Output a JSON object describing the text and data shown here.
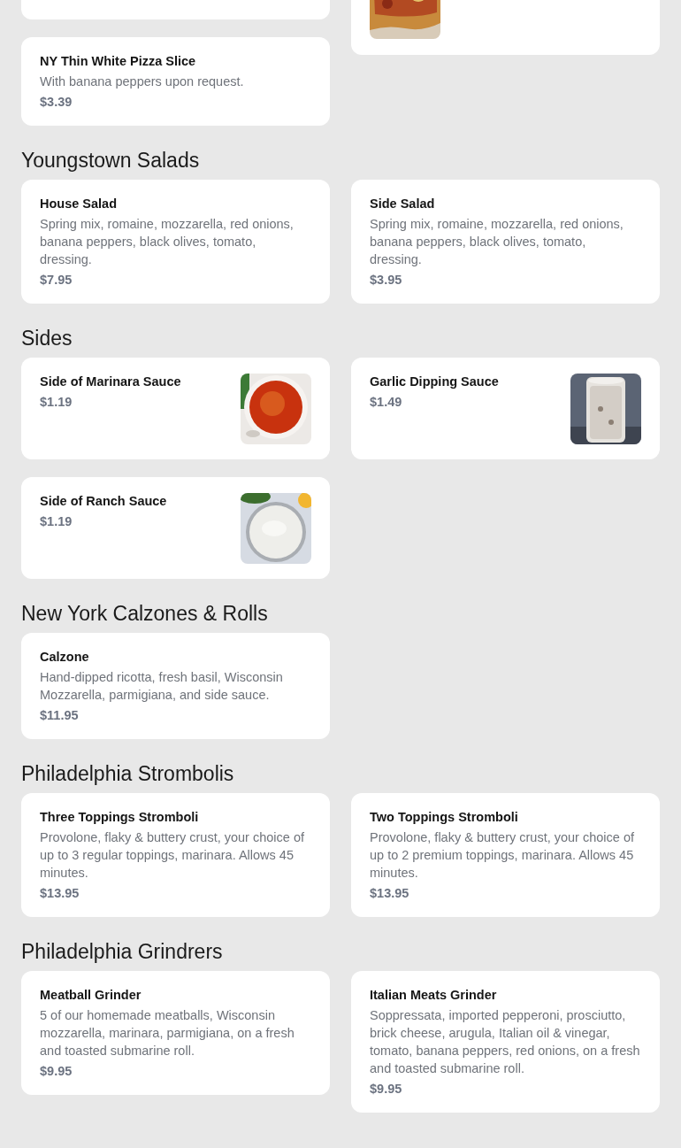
{
  "sections": [
    {
      "items": [
        {
          "kind": "cut"
        },
        {
          "kind": "cut"
        },
        {
          "kind": "item",
          "name": "NY Thin White Pizza Slice",
          "description": "With banana peppers upon request.",
          "price": "$3.39"
        }
      ]
    },
    {
      "heading": "Youngstown Salads",
      "items": [
        {
          "kind": "item",
          "name": "House Salad",
          "description": "Spring mix, romaine, mozzarella, red onions, banana peppers, black olives, tomato, dressing.",
          "price": "$7.95"
        },
        {
          "kind": "item",
          "name": "Side Salad",
          "description": "Spring mix, romaine, mozzarella, red onions, banana peppers, black olives, tomato, dressing.",
          "price": "$3.95"
        }
      ]
    },
    {
      "heading": "Sides",
      "items": [
        {
          "kind": "item",
          "name": "Side of Marinara Sauce",
          "price": "$1.19"
        },
        {
          "kind": "item",
          "name": "Garlic Dipping Sauce",
          "price": "$1.49"
        },
        {
          "kind": "item",
          "name": "Side of Ranch Sauce",
          "price": "$1.19"
        }
      ]
    },
    {
      "heading": "New York Calzones & Rolls",
      "items": [
        {
          "kind": "item",
          "name": "Calzone",
          "description": "Hand-dipped ricotta, fresh basil, Wisconsin Mozzarella, parmigiana, and side sauce.",
          "price": "$11.95"
        }
      ]
    },
    {
      "heading": "Philadelphia Strombolis",
      "items": [
        {
          "kind": "item",
          "name": "Three Toppings Stromboli",
          "description": "Provolone, flaky & buttery crust, your choice of up to 3 regular toppings, marinara. Allows 45 minutes.",
          "price": "$13.95"
        },
        {
          "kind": "item",
          "name": "Two Toppings Stromboli",
          "description": "Provolone, flaky & buttery crust, your choice of up to 2 premium toppings, marinara. Allows 45 minutes.",
          "price": "$13.95"
        }
      ]
    },
    {
      "heading": "Philadelphia Grindrers",
      "items": [
        {
          "kind": "item",
          "name": "Meatball Grinder",
          "description": "5 of our homemade meatballs, Wisconsin mozzarella, marinara, parmigiana, on a fresh and toasted submarine roll.",
          "price": "$9.95"
        },
        {
          "kind": "item",
          "name": "Italian Meats Grinder",
          "description": "Soppressata, imported pepperoni, prosciutto, brick cheese, arugula, Italian oil & vinegar, tomato, banana peppers, red onions, on a fresh and toasted submarine roll.",
          "price": "$9.95"
        }
      ]
    }
  ]
}
